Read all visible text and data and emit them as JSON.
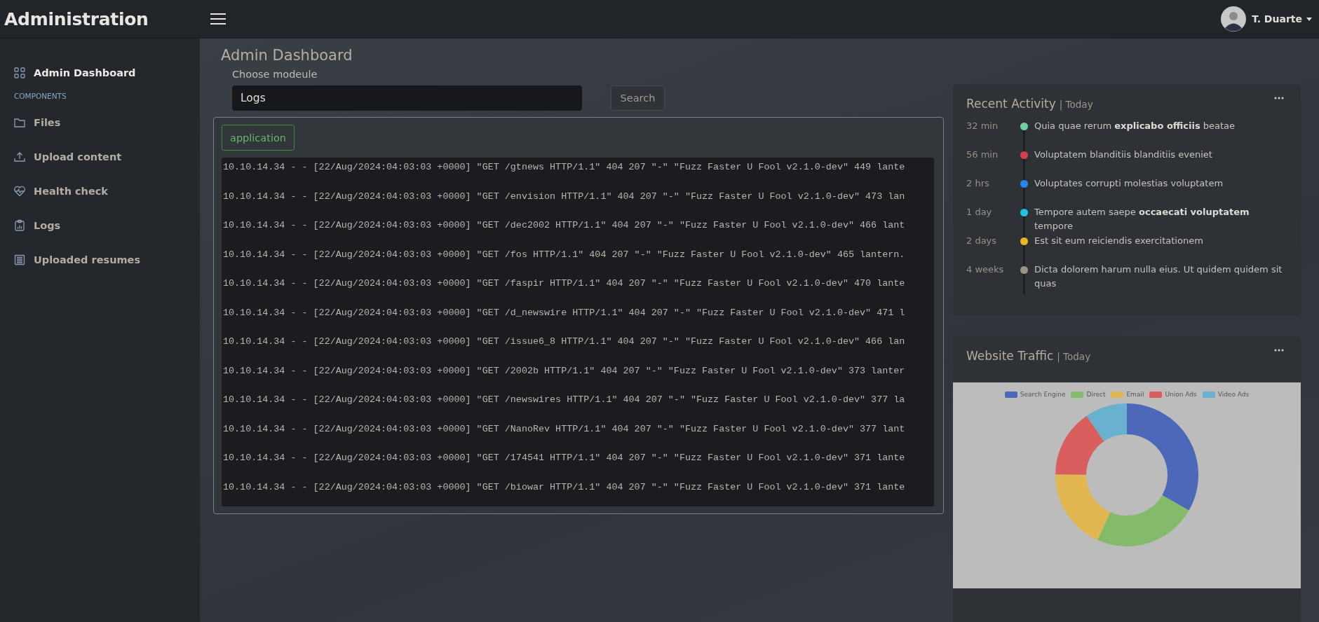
{
  "header": {
    "brand": "Administration",
    "user": {
      "name": "T. Duarte"
    }
  },
  "sidebar": {
    "items": [
      {
        "kind": "link",
        "label": "Admin Dashboard",
        "selected": true
      },
      {
        "kind": "heading",
        "label": "COMPONENTS"
      },
      {
        "kind": "link",
        "label": "Files",
        "selected": false
      },
      {
        "kind": "link",
        "label": "Upload content",
        "selected": false
      },
      {
        "kind": "link",
        "label": "Health check",
        "selected": false
      },
      {
        "kind": "link",
        "label": "Logs",
        "selected": false
      },
      {
        "kind": "link",
        "label": "Uploaded resumes",
        "selected": false
      }
    ]
  },
  "page_title": "Admin Dashboard",
  "module_form": {
    "label": "Choose modeule",
    "value": "Logs",
    "button": "Search"
  },
  "log_panel": {
    "tab": "application",
    "lines": [
      "10.10.14.34 - - [22/Aug/2024:04:03:03 +0000] \"GET /gtnews HTTP/1.1\" 404 207 \"-\" \"Fuzz Faster U Fool v2.1.0-dev\" 449 lante",
      "10.10.14.34 - - [22/Aug/2024:04:03:03 +0000] \"GET /envision HTTP/1.1\" 404 207 \"-\" \"Fuzz Faster U Fool v2.1.0-dev\" 473 lan",
      "10.10.14.34 - - [22/Aug/2024:04:03:03 +0000] \"GET /dec2002 HTTP/1.1\" 404 207 \"-\" \"Fuzz Faster U Fool v2.1.0-dev\" 466 lant",
      "10.10.14.34 - - [22/Aug/2024:04:03:03 +0000] \"GET /fos HTTP/1.1\" 404 207 \"-\" \"Fuzz Faster U Fool v2.1.0-dev\" 465 lantern.",
      "10.10.14.34 - - [22/Aug/2024:04:03:03 +0000] \"GET /faspir HTTP/1.1\" 404 207 \"-\" \"Fuzz Faster U Fool v2.1.0-dev\" 470 lante",
      "10.10.14.34 - - [22/Aug/2024:04:03:03 +0000] \"GET /d_newswire HTTP/1.1\" 404 207 \"-\" \"Fuzz Faster U Fool v2.1.0-dev\" 471 l",
      "10.10.14.34 - - [22/Aug/2024:04:03:03 +0000] \"GET /issue6_8 HTTP/1.1\" 404 207 \"-\" \"Fuzz Faster U Fool v2.1.0-dev\" 466 lan",
      "10.10.14.34 - - [22/Aug/2024:04:03:03 +0000] \"GET /2002b HTTP/1.1\" 404 207 \"-\" \"Fuzz Faster U Fool v2.1.0-dev\" 373 lanter",
      "10.10.14.34 - - [22/Aug/2024:04:03:03 +0000] \"GET /newswires HTTP/1.1\" 404 207 \"-\" \"Fuzz Faster U Fool v2.1.0-dev\" 377 la",
      "10.10.14.34 - - [22/Aug/2024:04:03:03 +0000] \"GET /NanoRev HTTP/1.1\" 404 207 \"-\" \"Fuzz Faster U Fool v2.1.0-dev\" 377 lant",
      "10.10.14.34 - - [22/Aug/2024:04:03:03 +0000] \"GET /174541 HTTP/1.1\" 404 207 \"-\" \"Fuzz Faster U Fool v2.1.0-dev\" 371 lante",
      "10.10.14.34 - - [22/Aug/2024:04:03:03 +0000] \"GET /biowar HTTP/1.1\" 404 207 \"-\" \"Fuzz Faster U Fool v2.1.0-dev\" 371 lante"
    ]
  },
  "recent_activity": {
    "title": "Recent Activity",
    "subtitle": "| Today",
    "items": [
      {
        "time": "32 min",
        "text": "Quia quae rerum **explicabo officiis** beatae",
        "color": "#6fd3a0"
      },
      {
        "time": "56 min",
        "text": "Voluptatem blanditiis blanditiis eveniet",
        "color": "#d6404c"
      },
      {
        "time": "2 hrs",
        "text": "Voluptates corrupti molestias voluptatem",
        "color": "#2685ee"
      },
      {
        "time": "1 day",
        "text": "Tempore autem saepe **occaecati voluptatem** tempore",
        "color": "#22c3e2"
      },
      {
        "time": "2 days",
        "text": "Est sit eum reiciendis exercitationem",
        "color": "#ecb726"
      },
      {
        "time": "4 weeks",
        "text": "Dicta dolorem harum nulla eius. Ut quidem quidem sit quas",
        "color": "#9a9488"
      }
    ]
  },
  "website_traffic": {
    "title": "Website Traffic",
    "subtitle": "| Today",
    "legend": [
      {
        "label": "Search Engine",
        "color": "#4d67b9"
      },
      {
        "label": "Direct",
        "color": "#84bb6a"
      },
      {
        "label": "Email",
        "color": "#e2b650"
      },
      {
        "label": "Union Ads",
        "color": "#d85f5d"
      },
      {
        "label": "Video Ads",
        "color": "#6ab0cf"
      }
    ]
  }
}
